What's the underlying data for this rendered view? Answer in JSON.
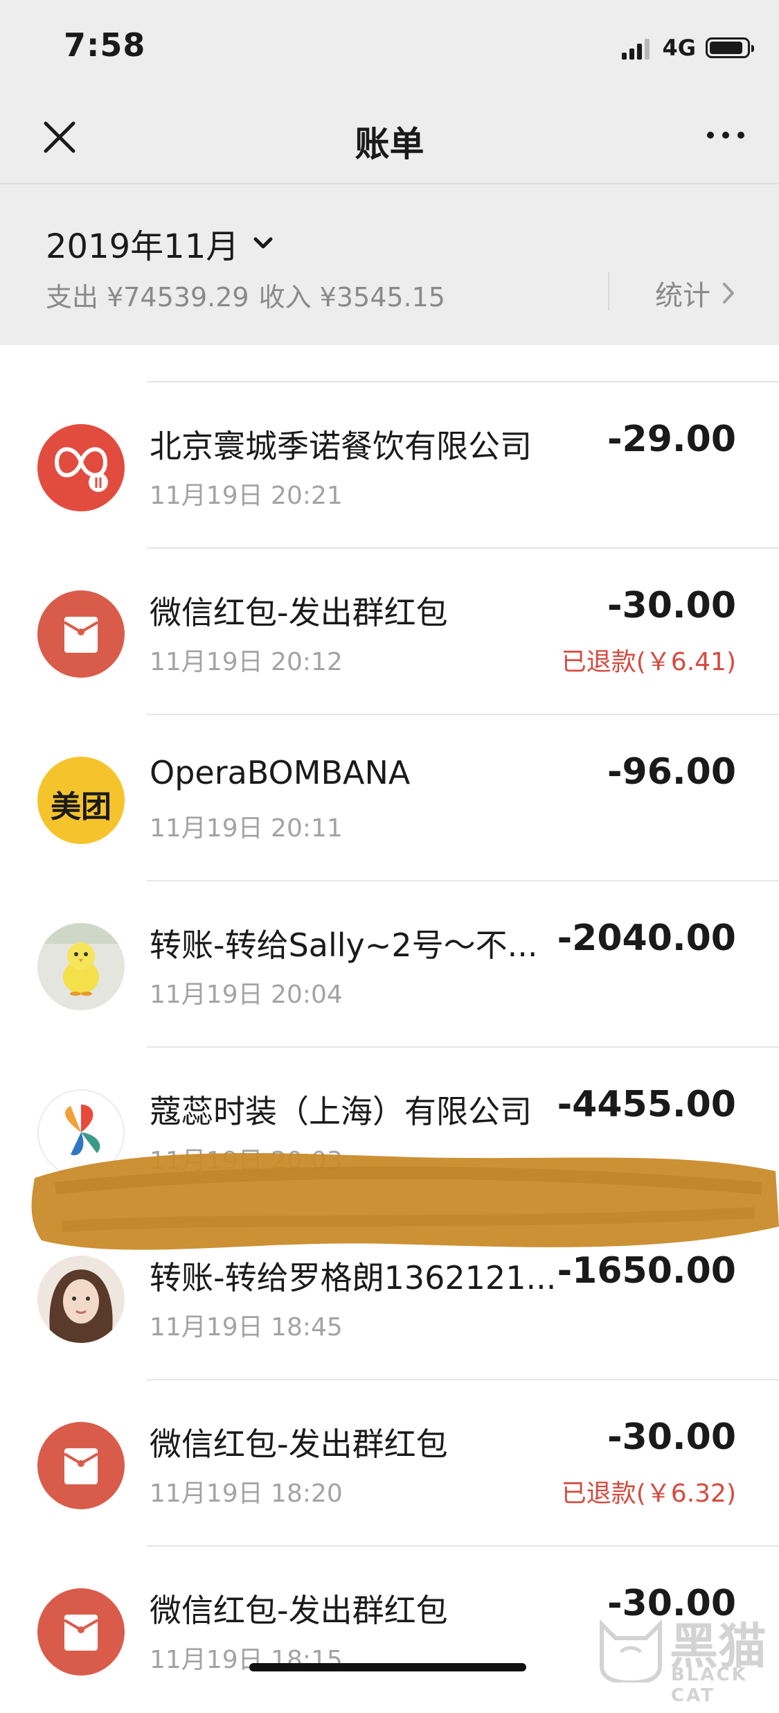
{
  "status_bar": {
    "time": "7:58",
    "network": "4G",
    "battery_level": 0.9
  },
  "nav": {
    "title": "账单",
    "close_icon": "close-icon",
    "more_icon": "more-icon"
  },
  "summary": {
    "month": "2019年11月",
    "expense": "支出 ¥74539.29",
    "income": "收入 ¥3545.15",
    "stats_label": "统计"
  },
  "transactions": [
    {
      "title": "北京寰城季诺餐饮有限公司",
      "time": "11月19日 20:21",
      "amount": "-29.00",
      "refund": "",
      "icon": "restaurant-logo-icon"
    },
    {
      "title": "微信红包-发出群红包",
      "time": "11月19日 20:12",
      "amount": "-30.00",
      "refund": "已退款(￥6.41)",
      "icon": "red-packet-icon"
    },
    {
      "title": "OperaBOMBANA",
      "time": "11月19日 20:11",
      "amount": "-96.00",
      "refund": "",
      "icon": "meituan-icon",
      "logo_text": "美团"
    },
    {
      "title": "转账-转给Sally~2号～不...",
      "time": "11月19日 20:04",
      "amount": "-2040.00",
      "refund": "",
      "icon": "chick-avatar"
    },
    {
      "title": "蔻蕊时装（上海）有限公司",
      "time": "11月19日 20:03",
      "amount": "-4455.00",
      "refund": "",
      "icon": "fashion-logo-icon"
    },
    {
      "title": "转账-转给罗格朗1362121...",
      "time": "11月19日 18:45",
      "amount": "-1650.00",
      "refund": "",
      "icon": "person-avatar"
    },
    {
      "title": "微信红包-发出群红包",
      "time": "11月19日 18:20",
      "amount": "-30.00",
      "refund": "已退款(￥6.32)",
      "icon": "red-packet-icon"
    },
    {
      "title": "微信红包-发出群红包",
      "time": "11月19日 18:15",
      "amount": "-30.00",
      "refund": "",
      "icon": "red-packet-icon"
    }
  ],
  "watermark": {
    "big": "黑猫",
    "small": "BLACK CAT"
  },
  "colors": {
    "header_bg": "#ededed",
    "refund": "#d54a3e",
    "red_packet": "#d95c4b",
    "meituan": "#f5c42c",
    "scribble": "#c98b2a"
  }
}
